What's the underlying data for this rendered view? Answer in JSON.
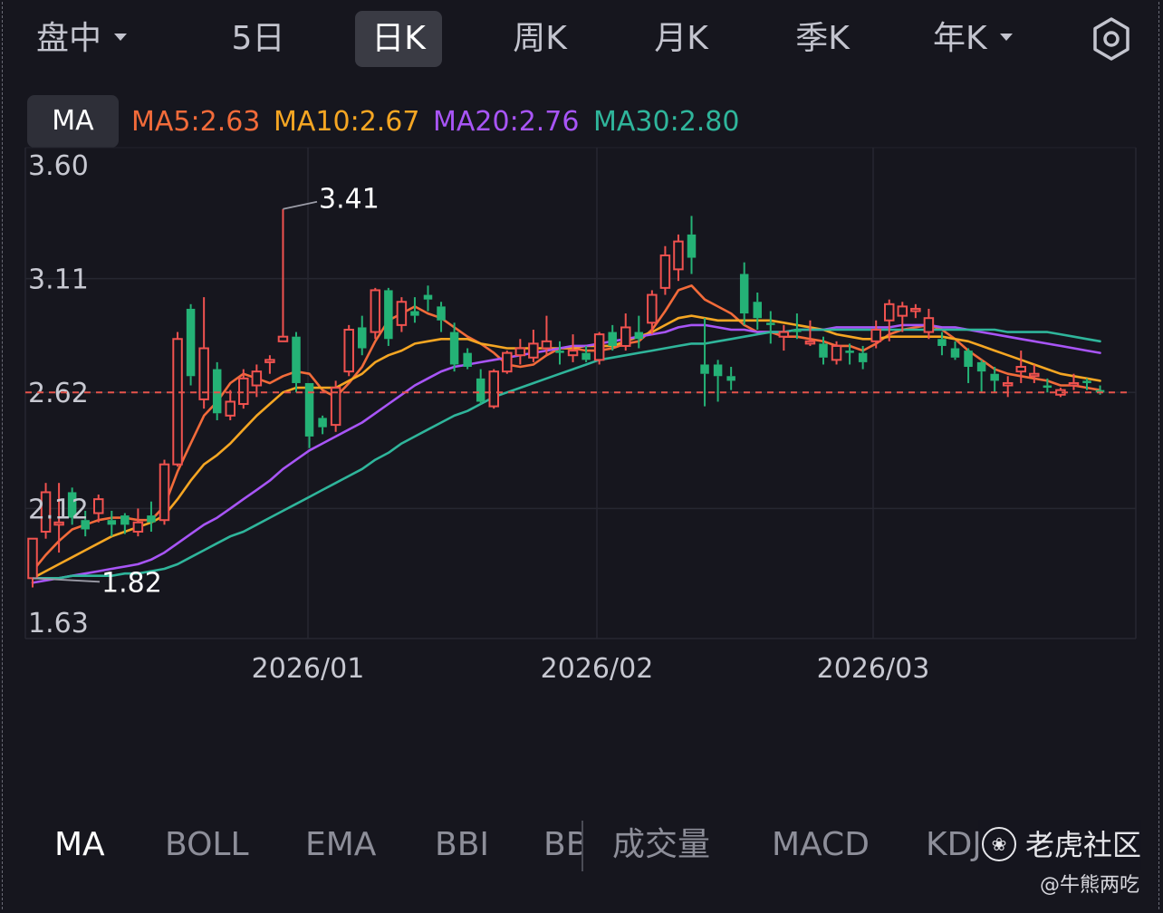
{
  "period_bar": {
    "items": [
      {
        "label": "盘中",
        "dropdown": true
      },
      {
        "label": "5日",
        "dropdown": false
      },
      {
        "label": "日K",
        "dropdown": false,
        "active": true
      },
      {
        "label": "周K",
        "dropdown": false
      },
      {
        "label": "月K",
        "dropdown": false
      },
      {
        "label": "季K",
        "dropdown": false
      },
      {
        "label": "年K",
        "dropdown": true
      }
    ],
    "settings_icon": "settings-circle-icon"
  },
  "legend": {
    "pill": "MA",
    "items": [
      {
        "text": "MA5:2.63",
        "color": "#f26b3a"
      },
      {
        "text": "MA10:2.67",
        "color": "#f5a623"
      },
      {
        "text": "MA20:2.76",
        "color": "#a855f7"
      },
      {
        "text": "MA30:2.80",
        "color": "#2fb59b"
      }
    ]
  },
  "chart_data": {
    "type": "candlestick",
    "y_ticks": [
      "3.60",
      "3.11",
      "2.62",
      "2.12",
      "1.63"
    ],
    "x_ticks": [
      "2026/01",
      "2026/02",
      "2026/03"
    ],
    "ylim": [
      1.63,
      3.6
    ],
    "current_price_line": 2.62,
    "annotations": [
      {
        "label": "3.41",
        "value": 3.41,
        "type": "period-high"
      },
      {
        "label": "1.82",
        "value": 1.82,
        "type": "period-low"
      }
    ],
    "colors": {
      "up": "#f0524f",
      "down": "#24b276",
      "grid": "#262731",
      "price_line": "#e5534b"
    },
    "candles": [
      [
        1.82,
        1.99,
        1.98,
        1.78
      ],
      [
        2.02,
        2.19,
        2.23,
        1.99
      ],
      [
        2.05,
        2.06,
        2.23,
        1.93
      ],
      [
        2.19,
        2.08,
        2.21,
        2.05
      ],
      [
        2.07,
        2.03,
        2.11,
        2.0
      ],
      [
        2.1,
        2.16,
        2.18,
        2.06
      ],
      [
        2.07,
        2.05,
        2.11,
        2.0
      ],
      [
        2.09,
        2.05,
        2.1,
        2.01
      ],
      [
        2.02,
        2.06,
        2.12,
        2.0
      ],
      [
        2.09,
        2.06,
        2.15,
        2.02
      ],
      [
        2.07,
        2.31,
        2.33,
        2.05
      ],
      [
        2.31,
        2.85,
        2.88,
        2.3
      ],
      [
        2.98,
        2.69,
        3.0,
        2.65
      ],
      [
        2.59,
        2.81,
        3.03,
        2.55
      ],
      [
        2.72,
        2.53,
        2.75,
        2.5
      ],
      [
        2.52,
        2.58,
        2.63,
        2.5
      ],
      [
        2.57,
        2.68,
        2.72,
        2.55
      ],
      [
        2.65,
        2.71,
        2.74,
        2.6
      ],
      [
        2.75,
        2.76,
        2.78,
        2.7
      ],
      [
        2.84,
        2.86,
        3.41,
        2.84
      ],
      [
        2.86,
        2.66,
        2.88,
        2.62
      ],
      [
        2.66,
        2.43,
        2.66,
        2.38
      ],
      [
        2.51,
        2.47,
        2.52,
        2.44
      ],
      [
        2.48,
        2.64,
        2.67,
        2.45
      ],
      [
        2.71,
        2.89,
        2.91,
        2.69
      ],
      [
        2.9,
        2.81,
        2.95,
        2.78
      ],
      [
        2.88,
        3.06,
        3.07,
        2.85
      ],
      [
        3.06,
        2.85,
        3.07,
        2.82
      ],
      [
        2.91,
        3.01,
        3.03,
        2.88
      ],
      [
        2.97,
        2.95,
        3.03,
        2.92
      ],
      [
        3.04,
        3.02,
        3.08,
        2.97
      ],
      [
        2.99,
        2.93,
        3.01,
        2.88
      ],
      [
        2.88,
        2.74,
        2.92,
        2.71
      ],
      [
        2.79,
        2.73,
        2.81,
        2.72
      ],
      [
        2.68,
        2.58,
        2.72,
        2.57
      ],
      [
        2.56,
        2.71,
        2.72,
        2.55
      ],
      [
        2.71,
        2.79,
        2.8,
        2.7
      ],
      [
        2.78,
        2.81,
        2.85,
        2.74
      ],
      [
        2.77,
        2.83,
        2.89,
        2.75
      ],
      [
        2.81,
        2.84,
        2.95,
        2.78
      ],
      [
        2.8,
        2.79,
        2.84,
        2.74
      ],
      [
        2.78,
        2.8,
        2.87,
        2.75
      ],
      [
        2.79,
        2.76,
        2.82,
        2.75
      ],
      [
        2.76,
        2.87,
        2.88,
        2.74
      ],
      [
        2.88,
        2.82,
        2.91,
        2.8
      ],
      [
        2.82,
        2.9,
        2.96,
        2.8
      ],
      [
        2.88,
        2.85,
        2.95,
        2.81
      ],
      [
        2.92,
        3.04,
        3.06,
        2.87
      ],
      [
        3.07,
        3.21,
        3.25,
        3.04
      ],
      [
        3.15,
        3.27,
        3.3,
        3.1
      ],
      [
        3.3,
        3.2,
        3.38,
        3.13
      ],
      [
        2.74,
        2.7,
        2.94,
        2.56
      ],
      [
        2.74,
        2.69,
        2.76,
        2.58
      ],
      [
        2.69,
        2.67,
        2.73,
        2.63
      ],
      [
        3.13,
        2.96,
        3.18,
        2.91
      ],
      [
        3.01,
        2.94,
        3.05,
        2.89
      ],
      [
        2.92,
        2.91,
        2.97,
        2.83
      ],
      [
        2.86,
        2.88,
        2.91,
        2.8
      ],
      [
        2.89,
        2.88,
        2.96,
        2.85
      ],
      [
        2.83,
        2.84,
        2.93,
        2.82
      ],
      [
        2.83,
        2.77,
        2.86,
        2.74
      ],
      [
        2.76,
        2.82,
        2.84,
        2.74
      ],
      [
        2.8,
        2.79,
        2.83,
        2.74
      ],
      [
        2.79,
        2.75,
        2.82,
        2.72
      ],
      [
        2.84,
        2.89,
        2.93,
        2.81
      ],
      [
        2.93,
        3.0,
        3.02,
        2.84
      ],
      [
        2.95,
        2.99,
        3.01,
        2.88
      ],
      [
        2.97,
        2.98,
        3.0,
        2.94
      ],
      [
        2.88,
        2.94,
        2.98,
        2.85
      ],
      [
        2.85,
        2.82,
        2.88,
        2.78
      ],
      [
        2.81,
        2.77,
        2.84,
        2.76
      ],
      [
        2.8,
        2.73,
        2.81,
        2.66
      ],
      [
        2.75,
        2.71,
        2.76,
        2.62
      ],
      [
        2.7,
        2.67,
        2.73,
        2.62
      ],
      [
        2.65,
        2.66,
        2.69,
        2.6
      ],
      [
        2.71,
        2.73,
        2.8,
        2.66
      ],
      [
        2.7,
        2.7,
        2.74,
        2.66
      ],
      [
        2.65,
        2.64,
        2.68,
        2.62
      ],
      [
        2.61,
        2.63,
        2.64,
        2.6
      ],
      [
        2.66,
        2.66,
        2.7,
        2.63
      ],
      [
        2.67,
        2.66,
        2.68,
        2.63
      ],
      [
        2.63,
        2.62,
        2.65,
        2.61
      ]
    ],
    "series": [
      {
        "name": "MA5",
        "color": "#f26b3a",
        "values": [
          1.85,
          1.92,
          1.98,
          2.03,
          2.05,
          2.07,
          2.08,
          2.08,
          2.07,
          2.07,
          2.13,
          2.28,
          2.4,
          2.52,
          2.58,
          2.66,
          2.7,
          2.68,
          2.66,
          2.69,
          2.71,
          2.7,
          2.63,
          2.6,
          2.66,
          2.73,
          2.84,
          2.93,
          2.96,
          2.99,
          2.96,
          2.94,
          2.9,
          2.86,
          2.83,
          2.79,
          2.74,
          2.73,
          2.74,
          2.78,
          2.81,
          2.81,
          2.8,
          2.8,
          2.81,
          2.83,
          2.84,
          2.89,
          2.97,
          3.06,
          3.08,
          3.02,
          2.99,
          2.96,
          2.91,
          2.88,
          2.88,
          2.86,
          2.86,
          2.85,
          2.84,
          2.82,
          2.82,
          2.8,
          2.83,
          2.87,
          2.89,
          2.9,
          2.91,
          2.89,
          2.85,
          2.8,
          2.76,
          2.72,
          2.7,
          2.69,
          2.68,
          2.67,
          2.65,
          2.65,
          2.64,
          2.63
        ]
      },
      {
        "name": "MA10",
        "color": "#f5a623",
        "values": [
          1.82,
          1.85,
          1.88,
          1.91,
          1.94,
          1.97,
          2.0,
          2.02,
          2.04,
          2.06,
          2.09,
          2.16,
          2.24,
          2.31,
          2.35,
          2.4,
          2.46,
          2.52,
          2.57,
          2.62,
          2.64,
          2.64,
          2.64,
          2.64,
          2.67,
          2.7,
          2.75,
          2.78,
          2.8,
          2.83,
          2.84,
          2.85,
          2.85,
          2.85,
          2.83,
          2.82,
          2.81,
          2.81,
          2.81,
          2.81,
          2.81,
          2.81,
          2.82,
          2.82,
          2.82,
          2.84,
          2.86,
          2.88,
          2.91,
          2.94,
          2.95,
          2.94,
          2.93,
          2.93,
          2.93,
          2.93,
          2.93,
          2.92,
          2.91,
          2.9,
          2.89,
          2.87,
          2.86,
          2.85,
          2.85,
          2.86,
          2.86,
          2.86,
          2.86,
          2.86,
          2.85,
          2.84,
          2.82,
          2.8,
          2.78,
          2.76,
          2.74,
          2.72,
          2.7,
          2.69,
          2.68,
          2.67
        ]
      },
      {
        "name": "MA20",
        "color": "#a855f7",
        "values": [
          1.8,
          1.81,
          1.82,
          1.83,
          1.84,
          1.85,
          1.86,
          1.87,
          1.88,
          1.9,
          1.93,
          1.97,
          2.01,
          2.05,
          2.08,
          2.12,
          2.16,
          2.2,
          2.24,
          2.29,
          2.33,
          2.37,
          2.4,
          2.43,
          2.46,
          2.49,
          2.53,
          2.57,
          2.61,
          2.65,
          2.68,
          2.71,
          2.73,
          2.74,
          2.75,
          2.76,
          2.77,
          2.78,
          2.79,
          2.8,
          2.81,
          2.82,
          2.82,
          2.83,
          2.84,
          2.85,
          2.86,
          2.87,
          2.88,
          2.9,
          2.91,
          2.91,
          2.9,
          2.89,
          2.89,
          2.88,
          2.88,
          2.88,
          2.89,
          2.89,
          2.89,
          2.9,
          2.9,
          2.9,
          2.9,
          2.9,
          2.91,
          2.91,
          2.91,
          2.9,
          2.9,
          2.89,
          2.88,
          2.87,
          2.86,
          2.85,
          2.84,
          2.83,
          2.82,
          2.81,
          2.8,
          2.79
        ]
      },
      {
        "name": "MA30",
        "color": "#2fb59b",
        "values": [
          1.82,
          1.82,
          1.82,
          1.83,
          1.83,
          1.83,
          1.83,
          1.84,
          1.84,
          1.85,
          1.86,
          1.88,
          1.91,
          1.94,
          1.97,
          2.0,
          2.02,
          2.05,
          2.08,
          2.11,
          2.14,
          2.17,
          2.2,
          2.23,
          2.26,
          2.29,
          2.33,
          2.36,
          2.4,
          2.43,
          2.46,
          2.49,
          2.52,
          2.54,
          2.57,
          2.6,
          2.62,
          2.64,
          2.66,
          2.68,
          2.7,
          2.72,
          2.74,
          2.76,
          2.77,
          2.78,
          2.79,
          2.8,
          2.81,
          2.82,
          2.83,
          2.83,
          2.84,
          2.85,
          2.86,
          2.87,
          2.88,
          2.88,
          2.89,
          2.89,
          2.89,
          2.89,
          2.89,
          2.89,
          2.89,
          2.89,
          2.89,
          2.89,
          2.89,
          2.89,
          2.89,
          2.89,
          2.89,
          2.89,
          2.88,
          2.88,
          2.88,
          2.88,
          2.87,
          2.86,
          2.85,
          2.84
        ]
      }
    ]
  },
  "indicator_tabs": {
    "items": [
      "MA",
      "BOLL",
      "EMA",
      "BBI",
      "BB",
      "成交量",
      "MACD",
      "KDJ"
    ],
    "active": "MA"
  },
  "watermark": {
    "brand": "老虎社区",
    "logo_icon": "tiger-logo-icon",
    "author": "@牛熊两吃"
  }
}
